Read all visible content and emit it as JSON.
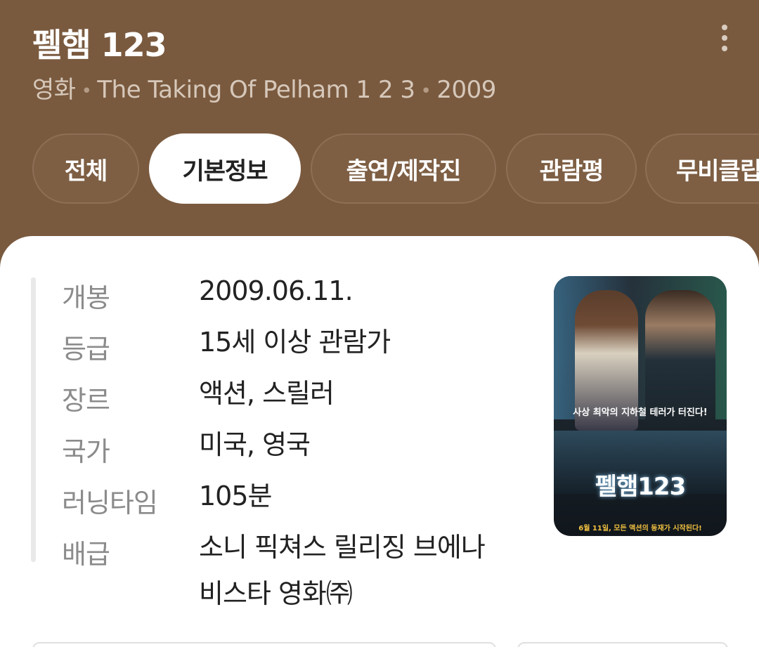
{
  "header": {
    "title": "펠햄 123",
    "subtitle": {
      "category": "영화",
      "original_title": "The Taking Of Pelham 1 2 3",
      "year": "2009"
    },
    "more_icon": "more-vertical-icon"
  },
  "tabs": [
    {
      "label": "전체",
      "active": false
    },
    {
      "label": "기본정보",
      "active": true
    },
    {
      "label": "출연/제작진",
      "active": false
    },
    {
      "label": "관람평",
      "active": false
    },
    {
      "label": "무비클립",
      "active": false
    }
  ],
  "info": [
    {
      "label": "개봉",
      "value": "2009.06.11."
    },
    {
      "label": "등급",
      "value": "15세 이상 관람가"
    },
    {
      "label": "장르",
      "value": "액션, 스릴러"
    },
    {
      "label": "국가",
      "value": "미국, 영국"
    },
    {
      "label": "러닝타임",
      "value": "105분"
    },
    {
      "label": "배급",
      "value": "소니 픽쳐스 릴리징 브에나 비스타 영화㈜"
    }
  ],
  "poster": {
    "tagline": "사상 최악의 지하철 테러가 터진다!",
    "title": "펠햄123",
    "bottom_text": "6월 11일, 모든 액션의 동재가 시작된다!"
  },
  "colors": {
    "header_bg": "#7a5a3f",
    "active_tab_bg": "#ffffff",
    "label_gray": "#8b8b8b"
  }
}
